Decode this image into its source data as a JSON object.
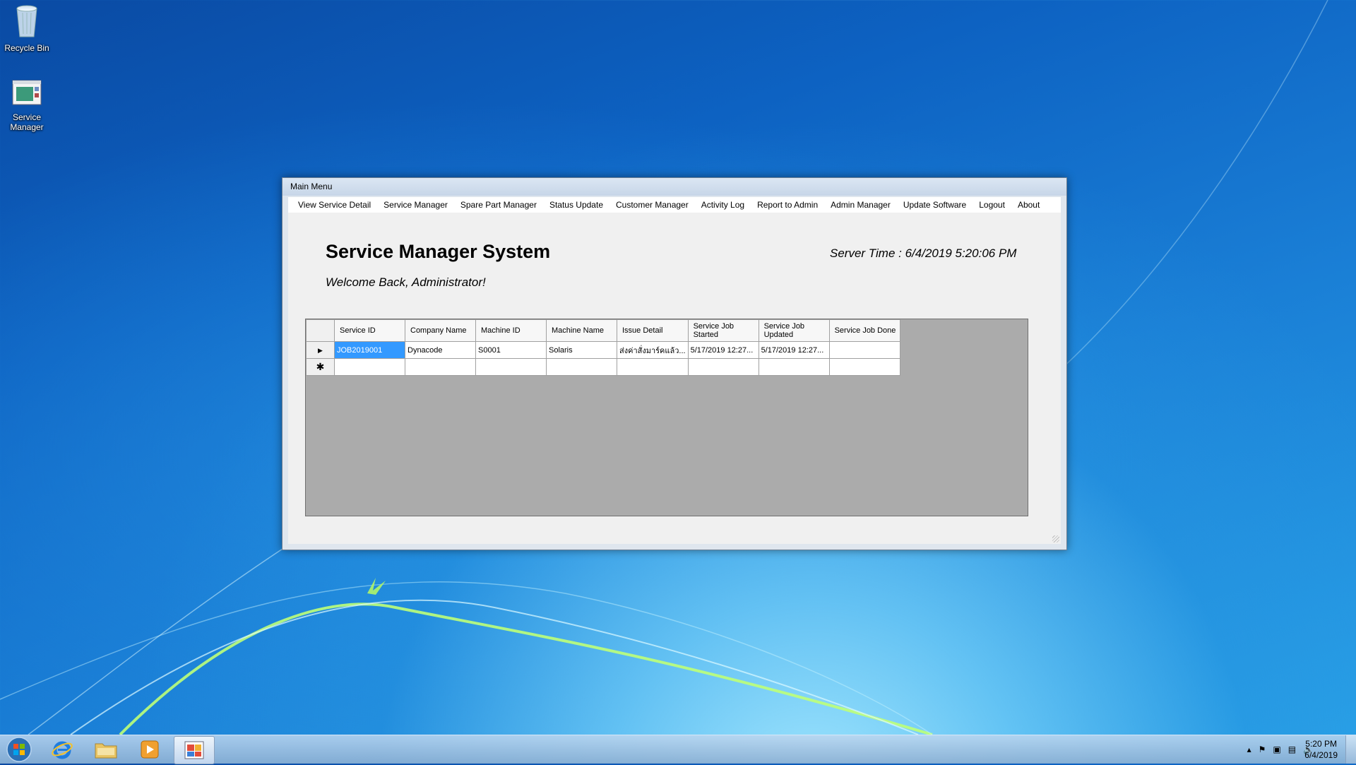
{
  "desktop": {
    "icons": [
      {
        "label": "Recycle Bin",
        "icon": "recycle-bin-icon"
      },
      {
        "label": "Service\nManager",
        "icon": "service-manager-icon"
      }
    ]
  },
  "window": {
    "title": "Main Menu",
    "menu": [
      "View Service Detail",
      "Service Manager",
      "Spare Part Manager",
      "Status Update",
      "Customer Manager",
      "Activity Log",
      "Report to Admin",
      "Admin Manager",
      "Update Software",
      "Logout",
      "About"
    ],
    "app_title": "Service Manager System",
    "welcome": "Welcome Back, Administrator!",
    "server_time_label": "Server Time :",
    "server_time_value": "6/4/2019 5:20:06 PM",
    "grid": {
      "columns": [
        "Service ID",
        "Company Name",
        "Machine ID",
        "Machine Name",
        "Issue Detail",
        "Service Job Started",
        "Service Job Updated",
        "Service Job Done"
      ],
      "rows": [
        [
          "JOB2019001",
          "Dynacode",
          "S0001",
          "Solaris",
          "ส่งค่าสั่งมาร์คแล้ว...",
          "5/17/2019 12:27...",
          "5/17/2019 12:27...",
          ""
        ]
      ],
      "current_row_marker": "▶",
      "new_row_marker": "✱"
    }
  },
  "taskbar": {
    "icons": [
      "start-orb-icon",
      "internet-explorer-icon",
      "file-explorer-icon",
      "media-player-icon",
      "service-manager-app-icon"
    ],
    "clock_time": "5:20 PM",
    "clock_date": "6/4/2019"
  }
}
